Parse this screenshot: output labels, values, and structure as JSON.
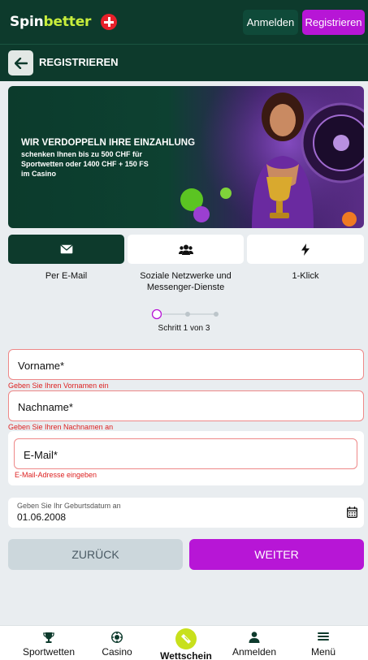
{
  "header": {
    "logo_part1": "Spin",
    "logo_part2": "better",
    "login_label": "Anmelden",
    "register_label": "Registrieren"
  },
  "titlebar": {
    "title": "REGISTRIEREN"
  },
  "banner": {
    "headline": "WIR VERDOPPELN IHRE EINZAHLUNG",
    "subline": "schenken Ihnen bis zu 500 CHF für Sportwetten oder 1400 CHF + 150 FS im Casino"
  },
  "tabs": [
    {
      "label": "Per E-Mail",
      "icon": "envelope-icon",
      "active": true
    },
    {
      "label": "Soziale Netzwerke und Messenger-Dienste",
      "icon": "users-icon",
      "active": false
    },
    {
      "label": "1-Klick",
      "icon": "bolt-icon",
      "active": false
    }
  ],
  "steps": {
    "text": "Schritt 1 von 3",
    "current": 1,
    "total": 3
  },
  "form": {
    "first_name": {
      "placeholder": "Vorname*",
      "error": "Geben Sie Ihren Vornamen ein"
    },
    "last_name": {
      "placeholder": "Nachname*",
      "error": "Geben Sie Ihren Nachnamen an"
    },
    "email": {
      "placeholder": "E-Mail*",
      "error": "E-Mail-Adresse eingeben"
    },
    "birthdate": {
      "label": "Geben Sie Ihr Geburtsdatum an",
      "value": "01.06.2008"
    }
  },
  "buttons": {
    "back": "ZURÜCK",
    "next": "WEITER"
  },
  "bottom_nav": [
    {
      "label": "Sportwetten",
      "icon": "trophy-icon"
    },
    {
      "label": "Casino",
      "icon": "casino-chip-icon"
    },
    {
      "label": "Wettschein",
      "icon": "ticket-icon",
      "active": true
    },
    {
      "label": "Anmelden",
      "icon": "user-icon"
    },
    {
      "label": "Menü",
      "icon": "menu-icon"
    }
  ],
  "colors": {
    "header_bg": "#0d3a2c",
    "accent_purple": "#b716d6",
    "error_red": "#dd2222",
    "wettschein_yellow": "#c8e01c"
  }
}
